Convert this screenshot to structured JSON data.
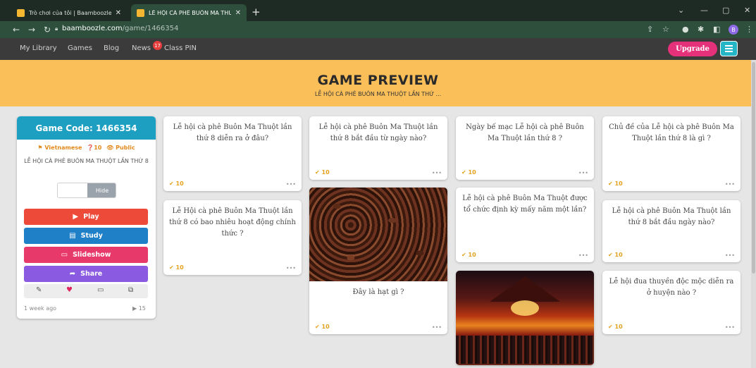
{
  "browser": {
    "tabs": [
      {
        "title": "Trò chơi của tôi | Baamboozle - B",
        "active": false
      },
      {
        "title": "LỄ HỘI CÀ PHÊ BUÔN MA THUỘ",
        "active": true
      }
    ],
    "url_host": "baamboozle.com",
    "url_path": "/game/1466354",
    "profile_initial": "B"
  },
  "site": {
    "nav": [
      "My Library",
      "Games",
      "Blog",
      "News",
      "Class PIN"
    ],
    "news_badge": "17",
    "upgrade_label": "Upgrade"
  },
  "banner": {
    "title": "GAME PREVIEW",
    "subtitle": "LỄ HỘI CÀ PHÊ BUÔN MA THUỘT LẦN THỨ ..."
  },
  "panel": {
    "game_code_label": "Game Code: 1466354",
    "language": "Vietnamese",
    "question_count": "10",
    "visibility": "Public",
    "game_title": "LỄ HỘI CÀ PHÊ BUÔN MA THUỘT LẦN THỨ 8",
    "hide_label": "Hide",
    "buttons": {
      "play": "Play",
      "study": "Study",
      "slideshow": "Slideshow",
      "share": "Share"
    },
    "colors": {
      "header": "#1c9fc1",
      "play": "#ee4a3a",
      "study": "#1f7fc7",
      "slideshow": "#e83a6a",
      "share": "#8a5ae0"
    },
    "age": "1 week ago",
    "plays": "15"
  },
  "cards": [
    {
      "question": "Lễ hội cà phê Buôn Ma Thuột lần thứ 8 diễn ra ở đâu?",
      "points": "10"
    },
    {
      "question": "Lễ Hội cà phê Buôn Ma Thuột lần thứ 8 có bao nhiêu hoạt động chính thức ?",
      "points": "10"
    },
    {
      "question": "Lễ hội cà phê Buôn Ma Thuột lần thứ 8 bắt đầu từ ngày nào?",
      "points": "10"
    },
    {
      "question": "Đây là hạt gì ?",
      "points": "10",
      "image": "coffee-beans"
    },
    {
      "question": "Ngày bế mạc Lễ hội cà phê Buôn Ma Thuột lần thứ 8 ?",
      "points": "10"
    },
    {
      "question": "Lễ hội cà phê Buôn Ma Thuột được tổ chức định kỳ mấy năm một lần?",
      "points": "10"
    },
    {
      "question": "",
      "points": "",
      "image": "festival-stage"
    },
    {
      "question": "Chủ đề của Lễ hội cà phê Buôn Ma Thuột lần thứ 8 là gì ?",
      "points": "10"
    },
    {
      "question": "Lễ hội cà phê Buôn Ma Thuột lần thứ 8 bắt đầu ngày nào?",
      "points": "10"
    },
    {
      "question": "Lễ hội đua thuyền độc mộc diễn ra ở huyện nào ?",
      "points": "10"
    }
  ],
  "ui_icons": {
    "check": "✔",
    "more": "•••"
  }
}
